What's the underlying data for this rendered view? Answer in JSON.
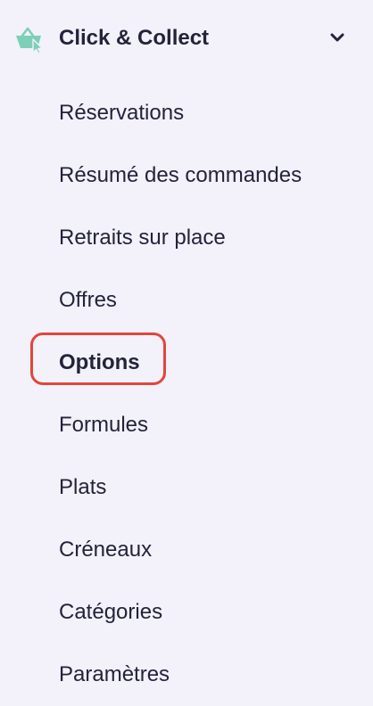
{
  "colors": {
    "background": "#f3f1fa",
    "text": "#23233a",
    "icon_accent": "#7ecfb7",
    "highlight_outline": "#e2463b"
  },
  "section": {
    "title": "Click & Collect",
    "icon": "basket-cursor-icon",
    "toggle_icon": "chevron-down-icon",
    "expanded": true
  },
  "menu": {
    "items": [
      {
        "label": "Réservations",
        "active": false
      },
      {
        "label": "Résumé des commandes",
        "active": false
      },
      {
        "label": "Retraits sur place",
        "active": false
      },
      {
        "label": "Offres",
        "active": false
      },
      {
        "label": "Options",
        "active": true
      },
      {
        "label": "Formules",
        "active": false
      },
      {
        "label": "Plats",
        "active": false
      },
      {
        "label": "Créneaux",
        "active": false
      },
      {
        "label": "Catégories",
        "active": false
      },
      {
        "label": "Paramètres",
        "active": false
      }
    ]
  }
}
